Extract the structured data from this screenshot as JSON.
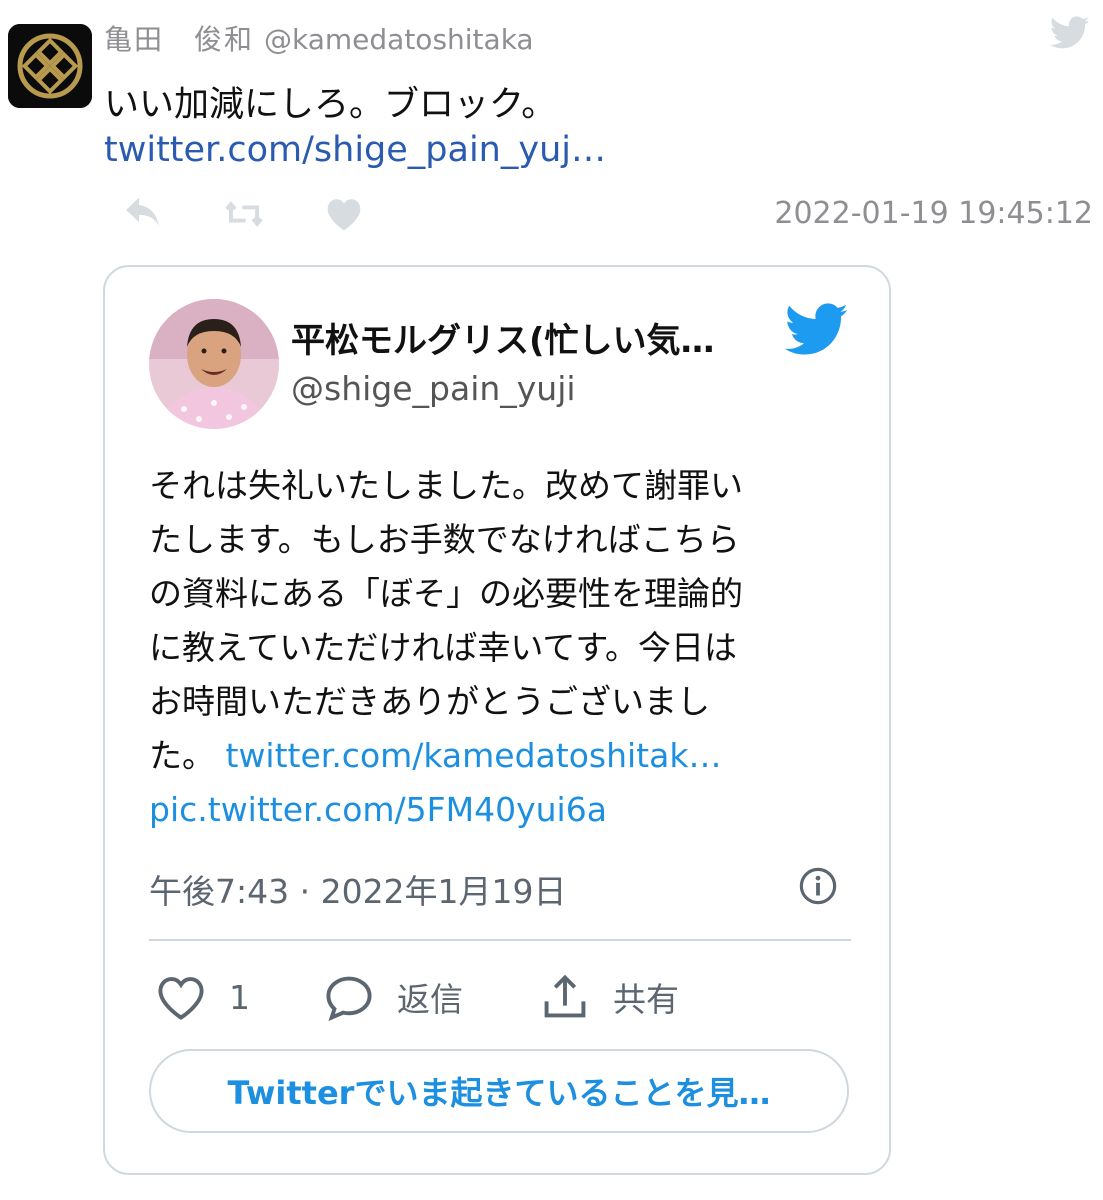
{
  "tweet": {
    "author_name": "亀田　俊和",
    "author_handle": "@kamedatoshitaka",
    "text": "いい加減にしろ。ブロック。",
    "link": "twitter.com/shige_pain_yuj…",
    "timestamp": "2022-01-19 19:45:12"
  },
  "embedded": {
    "author_name": "平松モルグリス(忙しい気…",
    "author_handle": "@shige_pain_yuji",
    "body_lines": [
      "それは失礼いたしました。改めて謝罪い",
      "たします。もしお手数でなければこちら",
      "の資料にある「ぼそ」の必要性を理論的",
      "に教えていただければ幸いてす。今日は",
      "お時間いただきありがとうございまし"
    ],
    "body_last_prefix": "た。 ",
    "body_link": "twitter.com/kamedatoshitak…",
    "body_pic": "pic.twitter.com/5FM40yui6a",
    "time": "午後7:43 · 2022年1月19日",
    "like_count": "1",
    "reply_label": "返信",
    "share_label": "共有",
    "cta": "Twitterでいま起きていることを見…"
  },
  "colors": {
    "link_dark": "#2a5bb0",
    "twitter_blue": "#1d8fe0",
    "muted": "#8e8e93",
    "border": "#cfd8de"
  },
  "icons": [
    "twitter-bird-icon",
    "reply-icon",
    "retweet-icon",
    "like-icon",
    "info-icon",
    "heart-outline-icon",
    "comment-icon",
    "share-icon"
  ]
}
